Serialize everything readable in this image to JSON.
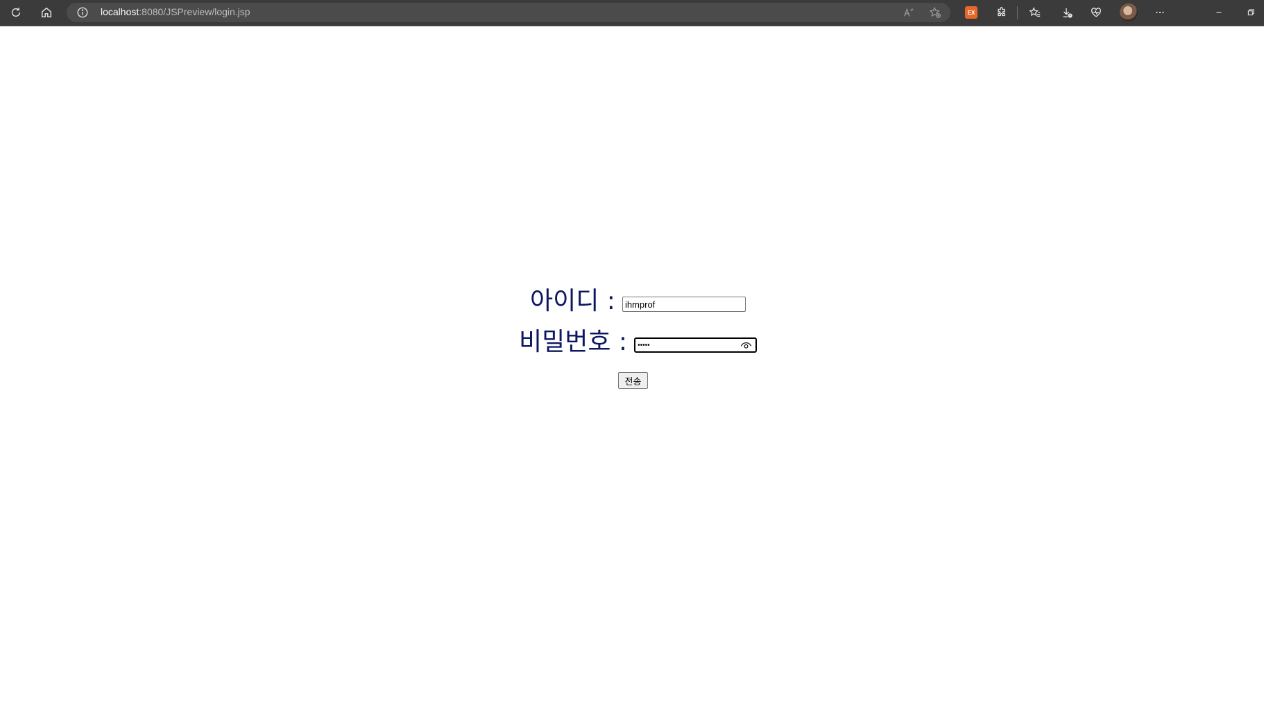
{
  "browser": {
    "url_host": "localhost",
    "url_rest": ":8080/JSPreview/login.jsp",
    "extension_badge": "EX",
    "icons": [
      "refresh-icon",
      "home-icon",
      "info-icon",
      "read-aloud-icon",
      "add-favorite-icon",
      "extension-icon",
      "puzzle-icon",
      "favorites-icon",
      "downloads-icon",
      "browser-essentials-icon",
      "profile-avatar",
      "more-icon",
      "minimize-icon",
      "restore-icon"
    ]
  },
  "form": {
    "id_label": "아이디 :",
    "id_value": "ihmprof",
    "pw_label": "비밀번호 :",
    "pw_value": "•••••",
    "submit_label": "전송"
  },
  "colors": {
    "label": "#0c1760",
    "toolbar": "#3b3b3b",
    "address_bar": "#4b4b4b"
  }
}
